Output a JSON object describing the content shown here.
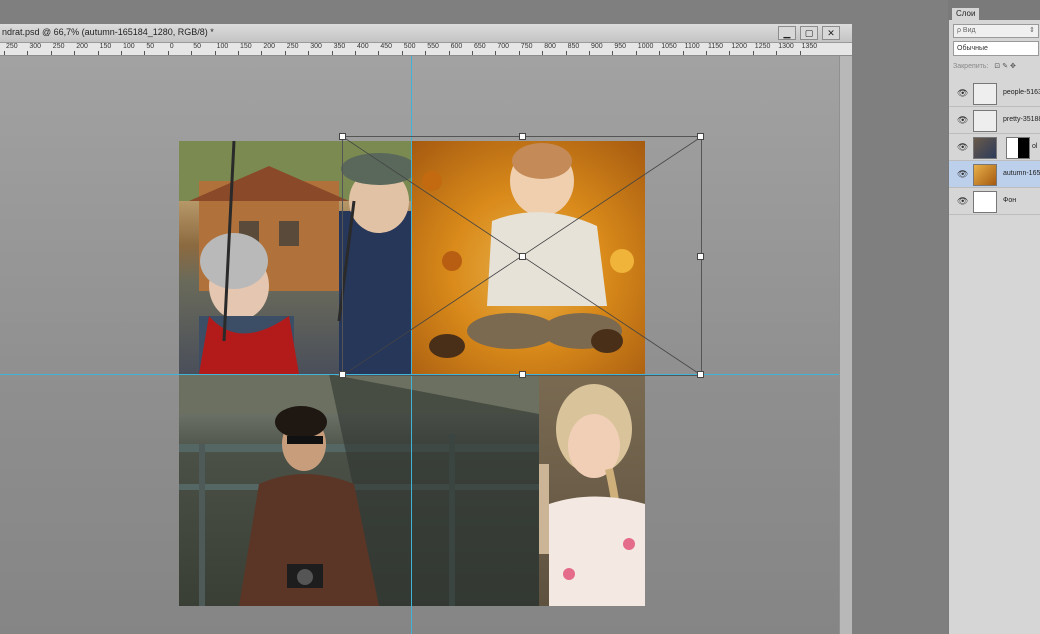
{
  "document": {
    "title": "ndrat.psd @ 66,7% (autumn-165184_1280, RGB/8) *",
    "buttons": {
      "minimize": "▁",
      "restore": "▢",
      "close": "✕"
    },
    "ruler_labels": [
      "250",
      "300",
      "250",
      "200",
      "150",
      "100",
      "50",
      "0",
      "50",
      "100",
      "150",
      "200",
      "250",
      "300",
      "350",
      "400",
      "450",
      "500",
      "550",
      "600",
      "650",
      "700",
      "750",
      "800",
      "850",
      "900",
      "950",
      "1000",
      "1050",
      "1100",
      "1150",
      "1200",
      "1250",
      "1300",
      "1350"
    ]
  },
  "canvas": {
    "photos": [
      {
        "name": "photo-elderly-couple",
        "subject": "elderly couple on a swing",
        "palette": [
          "#5a6a3c",
          "#c9a26e",
          "#2b3b5a",
          "#b52020",
          "#8c8c8c"
        ]
      },
      {
        "name": "photo-autumn-baby",
        "subject": "baby sitting in autumn leaves",
        "palette": [
          "#d98a1a",
          "#e8b04a",
          "#a55a10",
          "#e7e2d8"
        ]
      },
      {
        "name": "photo-young-man",
        "subject": "young man with camera at a playground",
        "palette": [
          "#3a3f36",
          "#4d5a57",
          "#5b3626",
          "#1d1d1d"
        ]
      },
      {
        "name": "photo-blonde-girl",
        "subject": "blonde girl with braid",
        "palette": [
          "#7a6a52",
          "#d9c39a",
          "#f4e9e2",
          "#e46b8a"
        ]
      }
    ],
    "colors": {
      "guide": "#3fb4d8",
      "canvas_bg": "#8e8e8e"
    }
  },
  "layers_panel": {
    "tab_label": "Слои",
    "filter_label": "ρ Вид",
    "filter_arrow": "⇕",
    "blend_mode": "Обычные",
    "locks_label": "Закрепить:",
    "lock_icons": "⊡ ✎ ✥",
    "layers": [
      {
        "name": "people-5163",
        "selected": false
      },
      {
        "name": "pretty-35188",
        "selected": false
      },
      {
        "name": "ol",
        "selected": false,
        "has_mask": true
      },
      {
        "name": "autumn-165",
        "selected": true
      },
      {
        "name": "Фон",
        "selected": false
      }
    ]
  }
}
